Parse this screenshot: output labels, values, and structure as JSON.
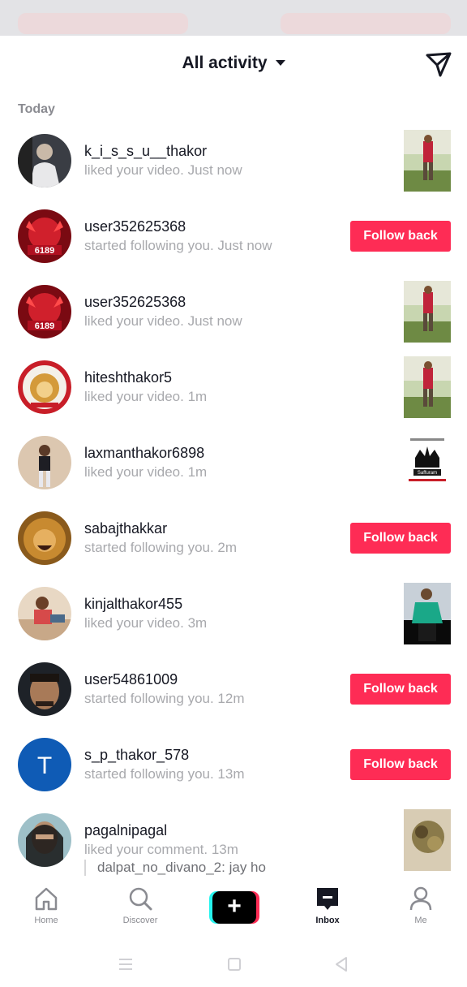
{
  "header": {
    "title": "All activity"
  },
  "sections": {
    "today_label": "Today"
  },
  "activities": [
    {
      "username": "k_i_s_s_u__thakor",
      "text": "liked your video. Just now",
      "action": "thumbnail",
      "avatar": "person-dark-bg",
      "thumb": "man-in-field"
    },
    {
      "username": "user352625368",
      "text": "started following you. Just now",
      "action": "follow",
      "avatar": "red-devil",
      "button": "Follow back"
    },
    {
      "username": "user352625368",
      "text": "liked your video. Just now",
      "action": "thumbnail",
      "avatar": "red-devil",
      "thumb": "man-in-field"
    },
    {
      "username": "hiteshthakor5",
      "text": "liked your video. 1m",
      "action": "thumbnail",
      "avatar": "lion-badge",
      "thumb": "man-in-field"
    },
    {
      "username": "laxmanthakor6898",
      "text": "liked your video. 1m",
      "action": "thumbnail",
      "avatar": "person-standing",
      "thumb": "crown-logo",
      "thumb_label": "Saffuram"
    },
    {
      "username": "sabajthakkar",
      "text": "started following you. 2m",
      "action": "follow",
      "avatar": "lion",
      "button": "Follow back"
    },
    {
      "username": "kinjalthakor455",
      "text": "liked your video. 3m",
      "action": "thumbnail",
      "avatar": "person-outdoor",
      "thumb": "man-green-shirt"
    },
    {
      "username": "user54861009",
      "text": "started following you. 12m",
      "action": "follow",
      "avatar": "man-face",
      "button": "Follow back"
    },
    {
      "username": "s_p_thakor_578",
      "text": "started following you. 13m",
      "action": "follow",
      "avatar": "letter-t",
      "avatar_letter": "T",
      "button": "Follow back"
    },
    {
      "username": "pagalnipagal",
      "text": "liked your comment. 13m",
      "action": "thumbnail",
      "avatar": "veiled-person",
      "thumb": "texture",
      "comment": "dalpat_no_divano_2: jay ho"
    }
  ],
  "nav": {
    "items": [
      {
        "label": "Home",
        "icon": "home-icon"
      },
      {
        "label": "Discover",
        "icon": "search-icon"
      },
      {
        "label": "",
        "icon": "plus-icon"
      },
      {
        "label": "Inbox",
        "icon": "inbox-icon",
        "active": true
      },
      {
        "label": "Me",
        "icon": "person-icon"
      }
    ]
  },
  "colors": {
    "accent": "#fe2c55",
    "text_primary": "#161823",
    "text_secondary": "#a8a9ad",
    "cyan": "#25f4ee"
  }
}
